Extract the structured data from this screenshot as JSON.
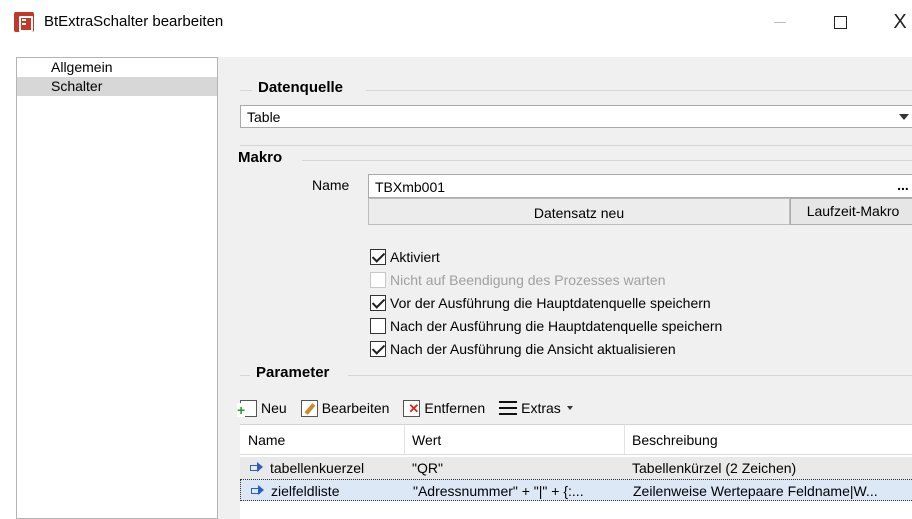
{
  "window": {
    "title": "BtExtraSchalter bearbeiten",
    "close_glyph": "X"
  },
  "sidebar": {
    "items": [
      {
        "label": "Allgemein",
        "selected": false
      },
      {
        "label": "Schalter",
        "selected": true
      }
    ]
  },
  "datenquelle": {
    "title": "Datenquelle",
    "value": "Table"
  },
  "makro": {
    "title": "Makro",
    "name_label": "Name",
    "name_value": "TBXmb001",
    "browse_label": "...",
    "record_label": "Datensatz neu",
    "runtime_button": "Laufzeit-Makro"
  },
  "options": [
    {
      "label": "Aktiviert",
      "checked": true,
      "disabled": false
    },
    {
      "label": "Nicht auf Beendigung des Prozesses warten",
      "checked": false,
      "disabled": true
    },
    {
      "label": "Vor der Ausführung die Hauptdatenquelle speichern",
      "checked": true,
      "disabled": false
    },
    {
      "label": "Nach der Ausführung die Hauptdatenquelle speichern",
      "checked": false,
      "disabled": false
    },
    {
      "label": "Nach der Ausführung die Ansicht aktualisieren",
      "checked": true,
      "disabled": false
    }
  ],
  "parameter": {
    "title": "Parameter",
    "toolbar": {
      "new_label": "Neu",
      "edit_label": "Bearbeiten",
      "delete_label": "Entfernen",
      "extras_label": "Extras"
    },
    "columns": [
      "Name",
      "Wert",
      "Beschreibung"
    ],
    "rows": [
      {
        "name": "tabellenkuerzel",
        "wert": "\"QR\"",
        "beschreibung": "Tabellenkürzel (2 Zeichen)"
      },
      {
        "name": "zielfeldliste",
        "wert": "\"Adressnummer\" + \"|\" + {:...",
        "beschreibung": "Zeilenweise Wertepaare Feldname|W..."
      }
    ]
  }
}
